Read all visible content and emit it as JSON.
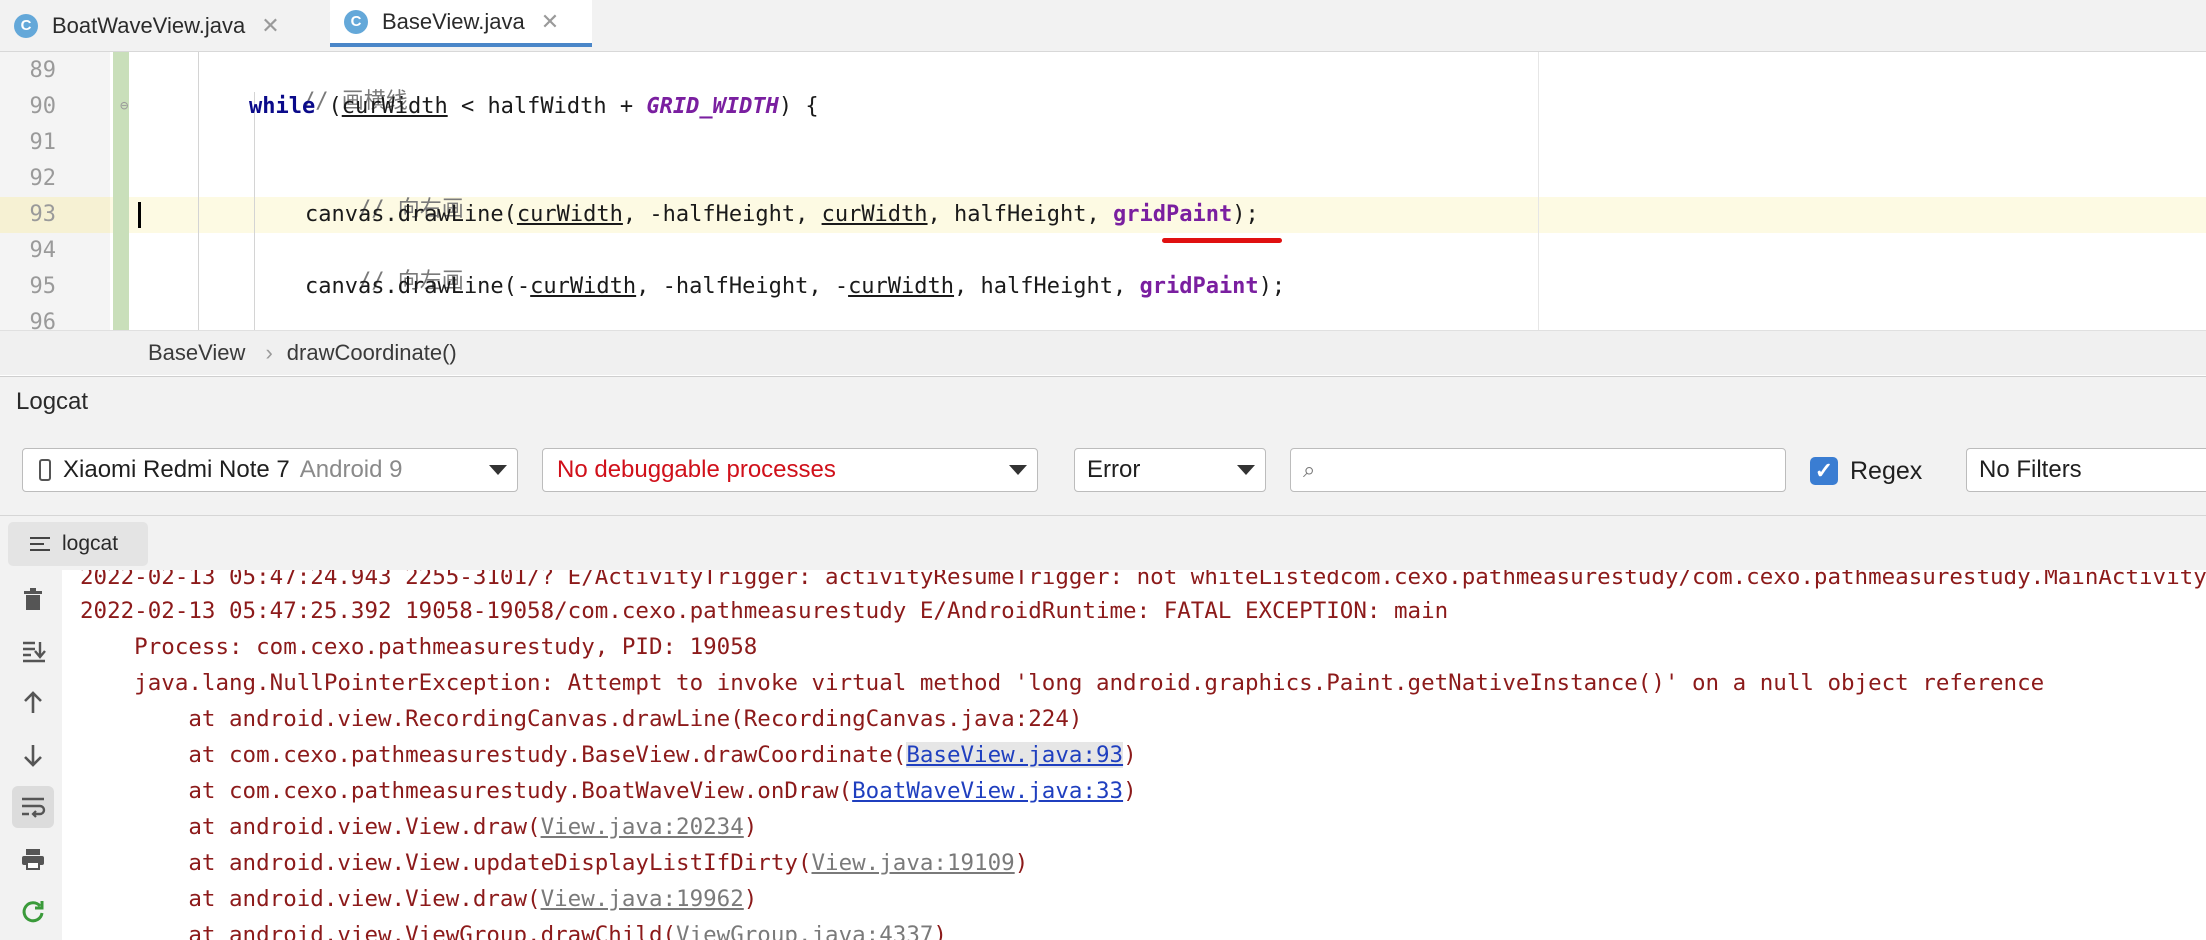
{
  "tabs": [
    {
      "icon": "C",
      "label": "BoatWaveView.java",
      "close": "✕",
      "active": false
    },
    {
      "icon": "C",
      "label": "BaseView.java",
      "close": "✕",
      "active": true
    }
  ],
  "editor": {
    "line_numbers": [
      "89",
      "90",
      "91",
      "92",
      "93",
      "94",
      "95",
      "96"
    ],
    "line89": {
      "comment": "// 画横线"
    },
    "line90": {
      "kw": "while",
      "p1": " (",
      "v1": "curWidth",
      "p2": " < halfWidth + ",
      "const": "GRID_WIDTH",
      "p3": ") {"
    },
    "line92": {
      "comment": "// 向右画"
    },
    "line93": {
      "p1": "canvas.drawLine(",
      "v1": "curWidth",
      "p2": ", -halfHeight, ",
      "v2": "curWidth",
      "p3": ", halfHeight, ",
      "field": "gridPaint",
      "p4": ");"
    },
    "line94": {
      "comment": "// 向左画"
    },
    "line95": {
      "p1": "canvas.drawLine(-",
      "v1": "curWidth",
      "p2": ", -halfHeight, -",
      "v2": "curWidth",
      "p3": ", halfHeight, ",
      "field": "gridPaint",
      "p4": ");"
    }
  },
  "breadcrumb": {
    "class": "BaseView",
    "sep": "›",
    "method": "drawCoordinate()"
  },
  "logcat": {
    "title": "Logcat",
    "device": {
      "name": "Xiaomi Redmi Note 7",
      "os": "Android 9"
    },
    "process": "No debuggable processes",
    "level": "Error",
    "search": {
      "value": "",
      "placeholder": ""
    },
    "regex": {
      "checked": true,
      "label": "Regex"
    },
    "filter": "No Filters",
    "tab_label": "logcat",
    "colors": {
      "log_text": "#8c1a1a",
      "link": "#1f3fbf",
      "process_red": "#d0101a",
      "regex_blue": "#3a7dd2"
    },
    "sidebar_icons": [
      "trash-icon",
      "scroll-to-end-icon",
      "arrow-up-icon",
      "arrow-down-icon",
      "soft-wrap-icon",
      "print-icon",
      "restart-icon"
    ],
    "lines": {
      "l1": "2022-02-13 05:47:24.943 2255-3101/? E/ActivityTrigger: activityResumeTrigger: not whiteListedcom.cexo.pathmeasurestudy/com.cexo.pathmeasurestudy.MainActivity",
      "l2": "2022-02-13 05:47:25.392 19058-19058/com.cexo.pathmeasurestudy E/AndroidRuntime: FATAL EXCEPTION: main",
      "l3": "    Process: com.cexo.pathmeasurestudy, PID: 19058",
      "l4": "    java.lang.NullPointerException: Attempt to invoke virtual method 'long android.graphics.Paint.getNativeInstance()' on a null object reference",
      "l5": "        at android.view.RecordingCanvas.drawLine(RecordingCanvas.java:224)",
      "l6_pre": "        at com.cexo.pathmeasurestudy.BaseView.drawCoordinate(",
      "l6_link": "BaseView.java:93",
      "l6_post": ")",
      "l7_pre": "        at com.cexo.pathmeasurestudy.BoatWaveView.onDraw(",
      "l7_link": "BoatWaveView.java:33",
      "l7_post": ")",
      "l8_pre": "        at android.view.View.draw(",
      "l8_link": "View.java:20234",
      "l8_post": ")",
      "l9_pre": "        at android.view.View.updateDisplayListIfDirty(",
      "l9_link": "View.java:19109",
      "l9_post": ")",
      "l10_pre": "        at android.view.View.draw(",
      "l10_link": "View.java:19962",
      "l10_post": ")",
      "l11_pre": "        at android.view.ViewGroup.drawChild(",
      "l11_link": "ViewGroup.java:4337",
      "l11_post": ")"
    }
  }
}
